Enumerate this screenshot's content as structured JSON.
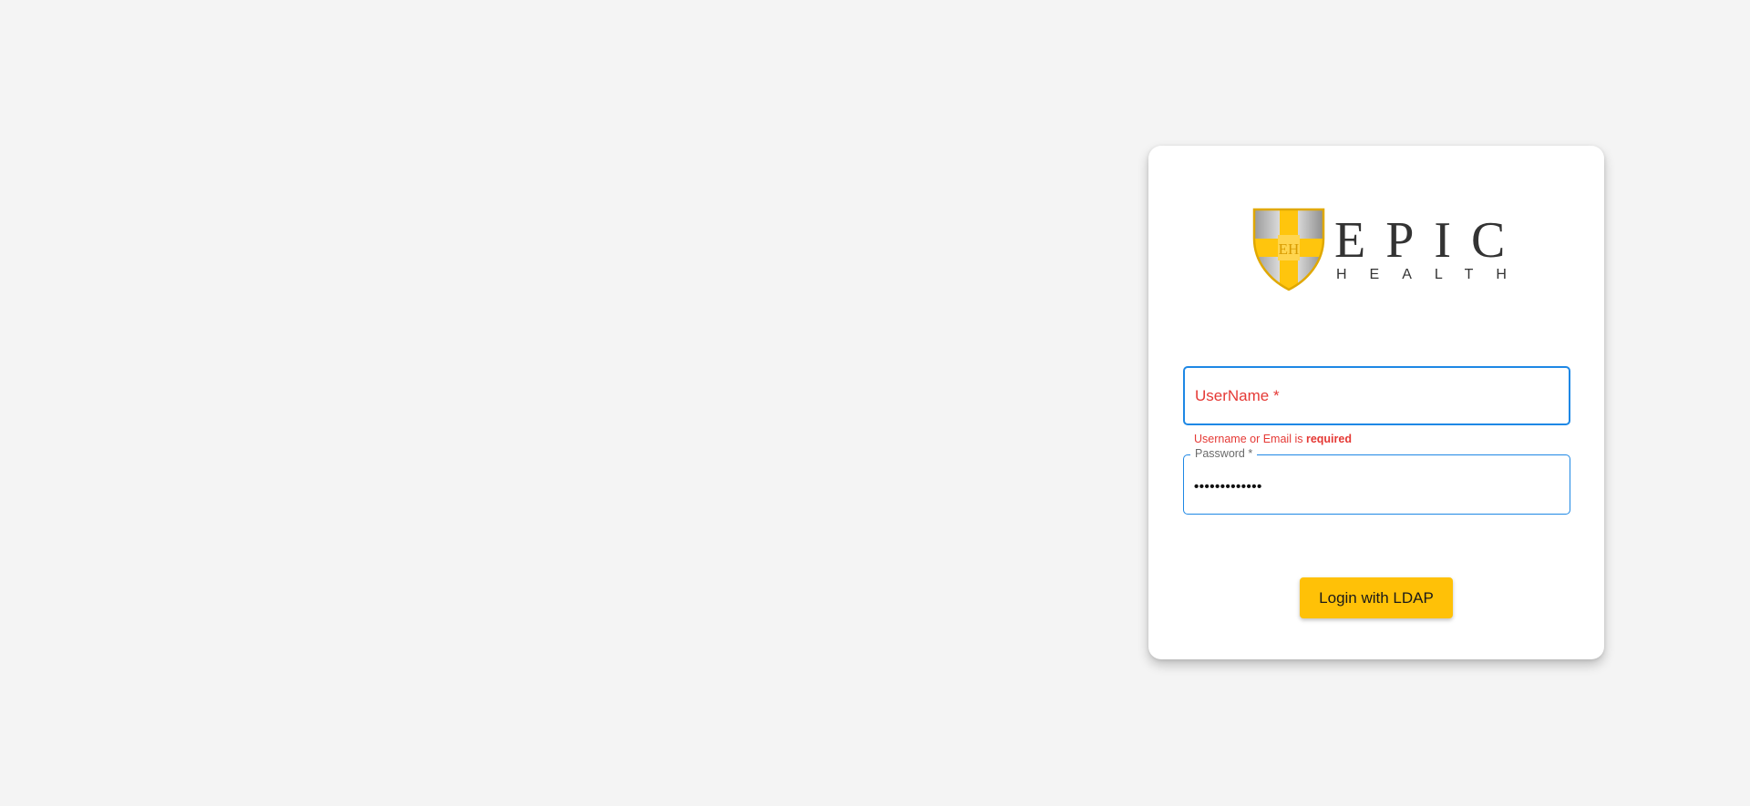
{
  "logo": {
    "shield_initials": "EH",
    "brand_name": "EPIC",
    "brand_sub": "HEALTH",
    "shield_color": "#ffc107",
    "text_color": "#333333"
  },
  "form": {
    "username": {
      "label": "UserName *",
      "error_prefix": "Username or Email is ",
      "error_emphasis": "required"
    },
    "password": {
      "label": "Password *",
      "value": "•••••••••••••"
    },
    "login_button_label": "Login with LDAP"
  },
  "colors": {
    "focus_border": "#1e88e5",
    "error": "#e53935",
    "button": "#ffc107",
    "page_background": "#f4f4f4"
  }
}
